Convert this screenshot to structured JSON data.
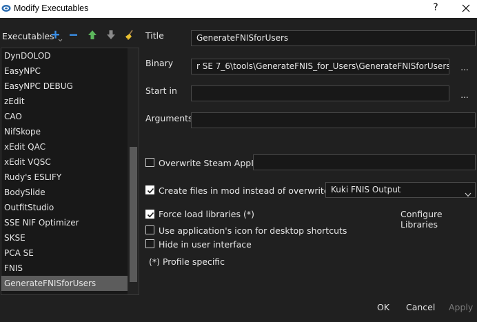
{
  "window": {
    "title": "Modify Executables",
    "help_label": "?"
  },
  "sidebar": {
    "label": "Executables",
    "items": [
      {
        "label": "DynDOLOD",
        "selected": false
      },
      {
        "label": "EasyNPC",
        "selected": false
      },
      {
        "label": "EasyNPC DEBUG",
        "selected": false
      },
      {
        "label": "zEdit",
        "selected": false
      },
      {
        "label": "CAO",
        "selected": false
      },
      {
        "label": "NifSkope",
        "selected": false
      },
      {
        "label": "xEdit QAC",
        "selected": false
      },
      {
        "label": "xEdit VQSC",
        "selected": false
      },
      {
        "label": "Rudy's ESLIFY",
        "selected": false
      },
      {
        "label": "BodySlide",
        "selected": false
      },
      {
        "label": "OutfitStudio",
        "selected": false
      },
      {
        "label": "SSE NIF Optimizer",
        "selected": false
      },
      {
        "label": "SKSE",
        "selected": false
      },
      {
        "label": "PCA SE",
        "selected": false
      },
      {
        "label": "FNIS",
        "selected": false
      },
      {
        "label": "GenerateFNISforUsers",
        "selected": true
      }
    ]
  },
  "form": {
    "title_label": "Title",
    "title_value": "GenerateFNISforUsers",
    "binary_label": "Binary",
    "binary_value": "r SE 7_6\\tools\\GenerateFNIS_for_Users\\GenerateFNISforUsers.exe",
    "start_in_label": "Start in",
    "start_in_value": "",
    "arguments_label": "Arguments",
    "arguments_value": "",
    "browse_label": "...",
    "overwrite_steam_label": "Overwrite Steam AppID",
    "overwrite_steam_checked": false,
    "steam_appid_value": "",
    "create_files_label": "Create files in mod instead of overwrite (*)",
    "create_files_checked": true,
    "create_files_mod": "Kuki FNIS Output",
    "force_load_label": "Force load libraries (*)",
    "force_load_checked": true,
    "configure_libraries_label": "Configure Libraries",
    "use_app_icon_label": "Use application's icon for desktop shortcuts",
    "use_app_icon_checked": false,
    "hide_label": "Hide in user interface",
    "hide_checked": false,
    "profile_note": "(*) Profile specific"
  },
  "footer": {
    "ok_label": "OK",
    "cancel_label": "Cancel",
    "apply_label": "Apply"
  },
  "colors": {
    "background": "#202020",
    "selected_item": "#5c5c5c",
    "add_icon": "#3a8ee6",
    "arrow_icon": "#5cb85c"
  }
}
